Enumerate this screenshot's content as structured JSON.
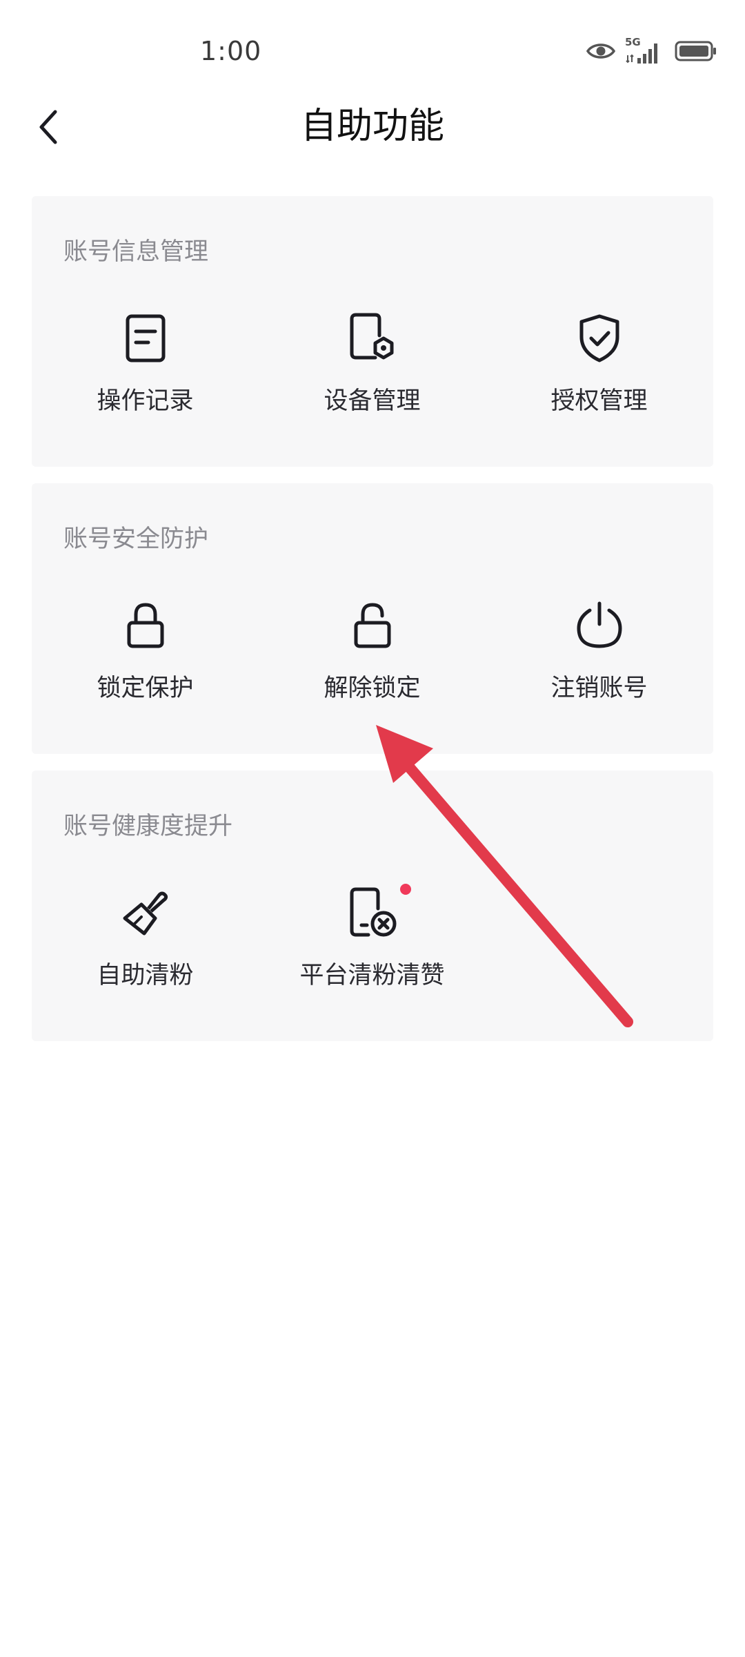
{
  "status_bar": {
    "time": "1:00",
    "network": "5G"
  },
  "header": {
    "title": "自助功能"
  },
  "sections": [
    {
      "title": "账号信息管理",
      "items": [
        {
          "label": "操作记录",
          "icon": "document-icon"
        },
        {
          "label": "设备管理",
          "icon": "device-settings-icon"
        },
        {
          "label": "授权管理",
          "icon": "shield-check-icon"
        }
      ]
    },
    {
      "title": "账号安全防护",
      "items": [
        {
          "label": "锁定保护",
          "icon": "lock-icon"
        },
        {
          "label": "解除锁定",
          "icon": "unlock-icon"
        },
        {
          "label": "注销账号",
          "icon": "power-icon"
        }
      ]
    },
    {
      "title": "账号健康度提升",
      "items": [
        {
          "label": "自助清粉",
          "icon": "brush-icon"
        },
        {
          "label": "平台清粉清赞",
          "icon": "phone-remove-icon",
          "badge": true
        }
      ]
    }
  ],
  "colors": {
    "card_bg": "#f7f7f8",
    "badge": "#f0395a",
    "annotation_arrow": "#e23a4b"
  }
}
